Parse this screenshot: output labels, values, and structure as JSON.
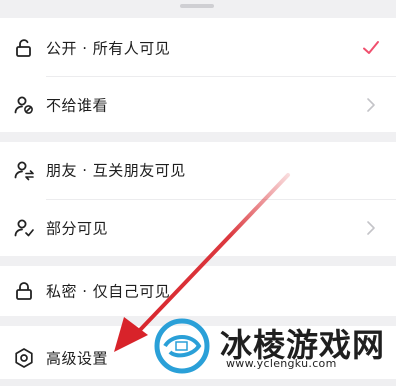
{
  "options": [
    {
      "label": "公开 · 所有人可见",
      "icon": "lock-open-icon",
      "trail": "checkmark-icon"
    },
    {
      "label": "不给谁看",
      "icon": "user-blocked-icon",
      "trail": "chevron-right-icon"
    },
    {
      "label": "朋友 · 互关朋友可见",
      "icon": "user-mutual-icon",
      "trail": ""
    },
    {
      "label": "部分可见",
      "icon": "user-partial-icon",
      "trail": "chevron-right-icon"
    },
    {
      "label": "私密 · 仅自己可见",
      "icon": "lock-closed-icon",
      "trail": ""
    },
    {
      "label": "高级设置",
      "icon": "settings-gear-icon",
      "trail": ""
    }
  ],
  "colors": {
    "check": "#f0506e",
    "arrow": "#d8232a",
    "watermark_ring": "#2aa0d8"
  },
  "watermark": {
    "text": "冰棱游戏网",
    "url": "www.yclengku.com"
  }
}
